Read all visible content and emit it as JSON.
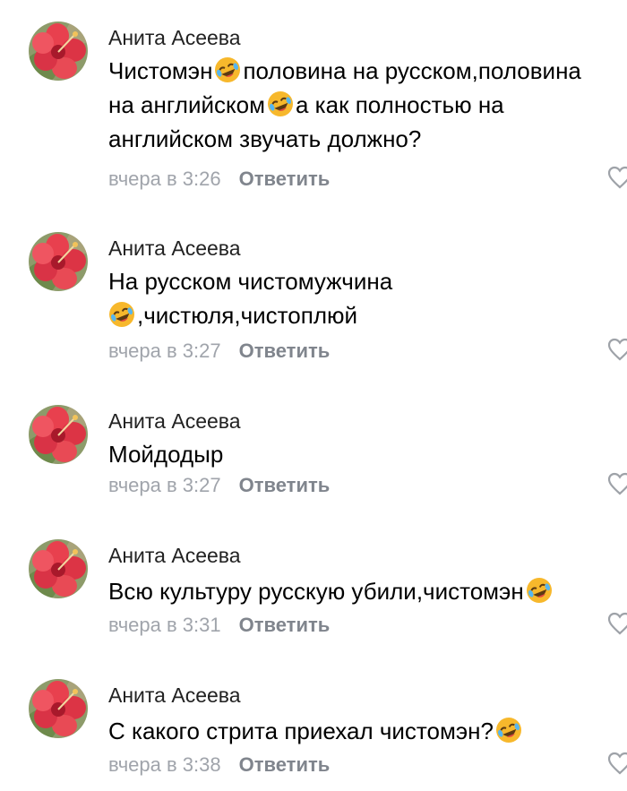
{
  "colors": {
    "author": "#222222",
    "text": "#000000",
    "time": "#a0a4ab",
    "reply": "#80858d",
    "like_icon": "#9ea2a8",
    "emoji_face": "#f7b82c"
  },
  "icons": {
    "avatar": "hibiscus-flower-photo",
    "emoji": "rolling-on-the-floor-laughing-emoji",
    "like": "heart-outline-icon"
  },
  "comments": [
    {
      "author": "Анита Асеева",
      "lines": [
        [
          "Чистомэн",
          "emoji",
          "половина на русском,половина"
        ],
        [
          "на английском",
          "emoji",
          "а как полностью на"
        ],
        [
          "английском звучать должно?"
        ]
      ],
      "time": "вчера в 3:26",
      "reply_label": "Ответить"
    },
    {
      "author": "Анита Асеева",
      "lines": [
        [
          "На русском чистомужчина"
        ],
        [
          "emoji",
          ",чистюля,чистоплюй"
        ]
      ],
      "time": "вчера в 3:27",
      "reply_label": "Ответить"
    },
    {
      "author": "Анита Асеева",
      "lines": [
        [
          "Мойдодыр"
        ]
      ],
      "time": "вчера в 3:27",
      "reply_label": "Ответить"
    },
    {
      "author": "Анита Асеева",
      "lines": [
        [
          "Всю культуру русскую убили,чистомэн",
          "emoji"
        ]
      ],
      "time": "вчера в 3:31",
      "reply_label": "Ответить"
    },
    {
      "author": "Анита Асеева",
      "lines": [
        [
          "С какого стрита приехал чистомэн?",
          "emoji"
        ]
      ],
      "time": "вчера в 3:38",
      "reply_label": "Ответить"
    }
  ]
}
